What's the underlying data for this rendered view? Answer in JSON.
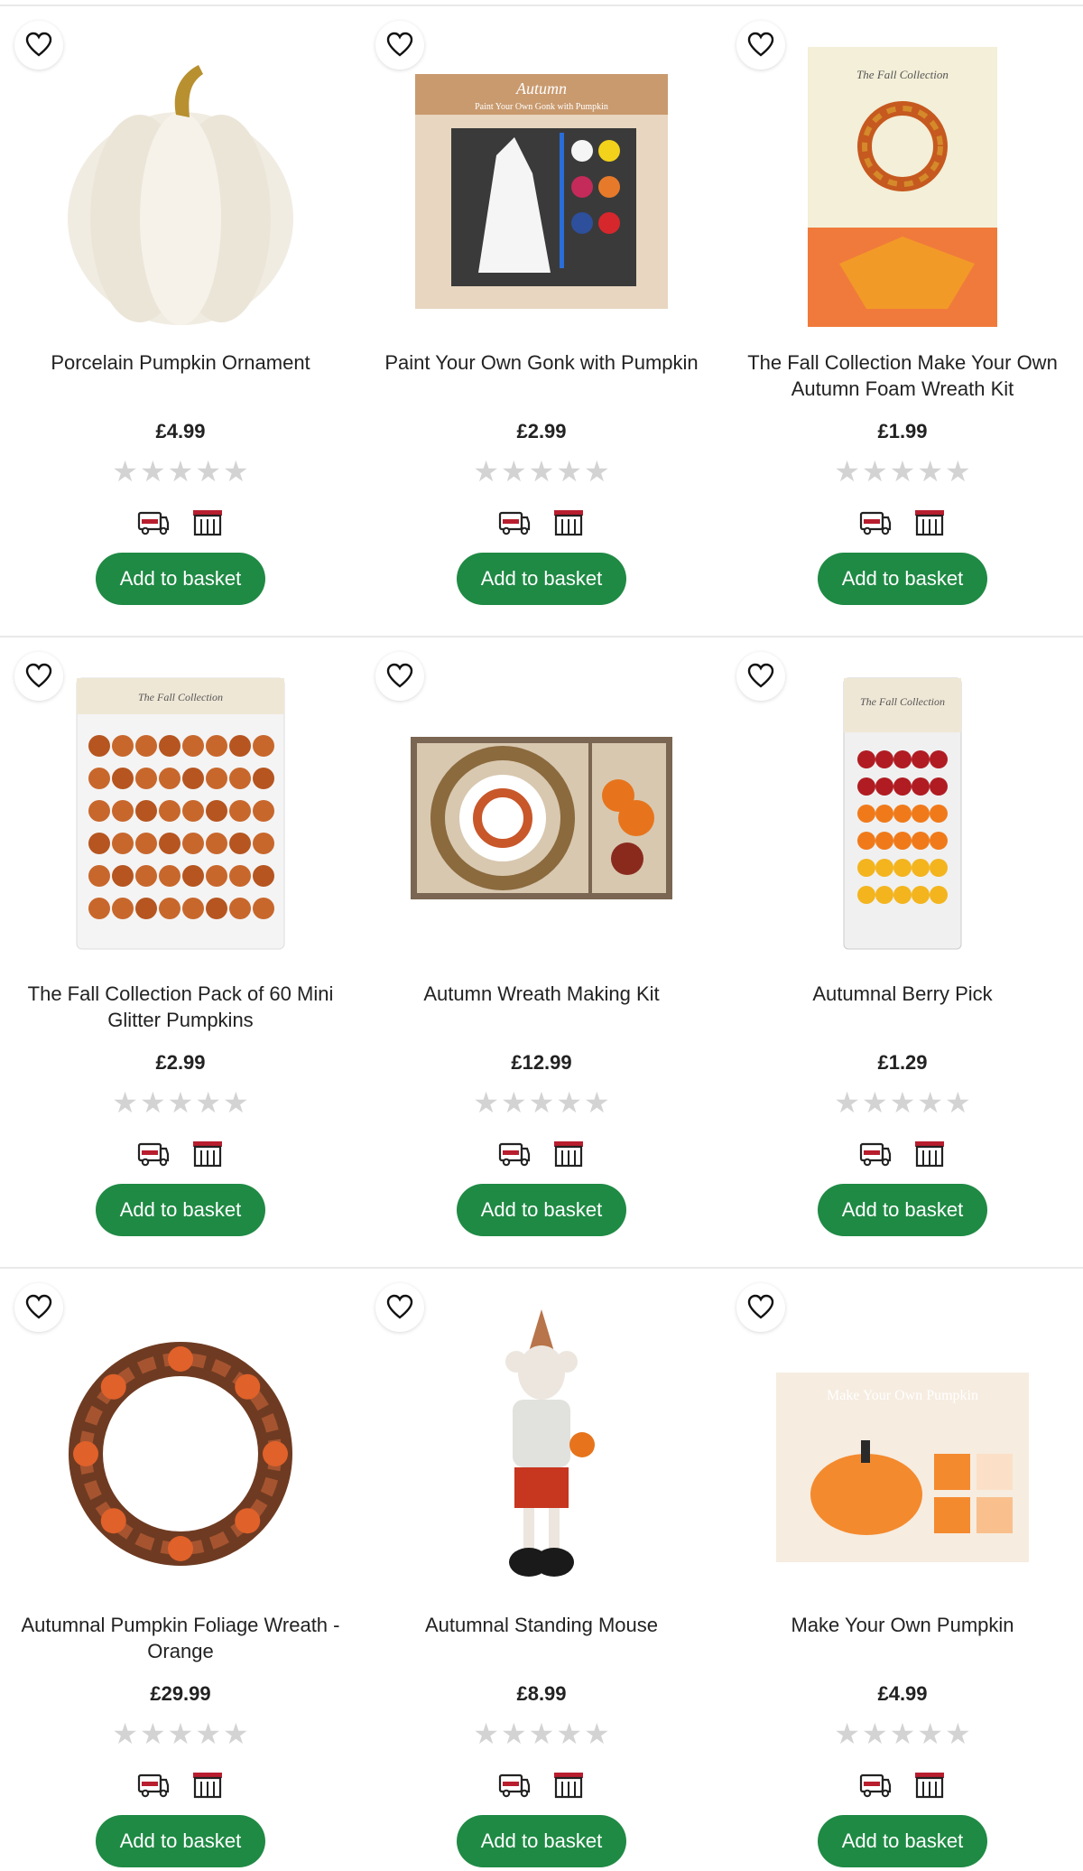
{
  "products": [
    {
      "name": "Porcelain Pumpkin Ornament",
      "price": "£4.99",
      "rating": 0,
      "button": "Add to basket",
      "image": "white-pumpkin"
    },
    {
      "name": "Paint Your Own Gonk with Pumpkin",
      "price": "£2.99",
      "rating": 0,
      "button": "Add to basket",
      "image": "gonk-kit",
      "box_title": "Autumn",
      "box_subtitle": "Paint Your Own Gonk with Pumpkin"
    },
    {
      "name": "The Fall Collection Make Your Own Autumn Foam Wreath Kit",
      "price": "£1.99",
      "rating": 0,
      "button": "Add to basket",
      "image": "foam-wreath-kit",
      "box_title": "The Fall Collection"
    },
    {
      "name": "The Fall Collection Pack of 60 Mini Glitter Pumpkins",
      "price": "£2.99",
      "rating": 0,
      "button": "Add to basket",
      "image": "glitter-pumpkins",
      "box_title": "The Fall Collection"
    },
    {
      "name": "Autumn Wreath Making Kit",
      "price": "£12.99",
      "rating": 0,
      "button": "Add to basket",
      "image": "wreath-making-kit"
    },
    {
      "name": "Autumnal Berry Pick",
      "price": "£1.29",
      "rating": 0,
      "button": "Add to basket",
      "image": "berry-pick",
      "box_title": "The Fall Collection"
    },
    {
      "name": "Autumnal Pumpkin Foliage Wreath - Orange",
      "price": "£29.99",
      "rating": 0,
      "button": "Add to basket",
      "image": "foliage-wreath"
    },
    {
      "name": "Autumnal Standing Mouse",
      "price": "£8.99",
      "rating": 0,
      "button": "Add to basket",
      "image": "standing-mouse"
    },
    {
      "name": "Make Your Own Pumpkin",
      "price": "£4.99",
      "rating": 0,
      "button": "Add to basket",
      "image": "make-pumpkin-kit",
      "box_title": "Make Your Own Pumpkin"
    }
  ],
  "icons": {
    "favourite": "heart-icon",
    "delivery": "van-icon",
    "collect": "store-icon",
    "star": "star-icon"
  },
  "colors": {
    "button": "#1f8a44",
    "star_empty": "#d3d3d3",
    "icon_red": "#b81e2e"
  }
}
